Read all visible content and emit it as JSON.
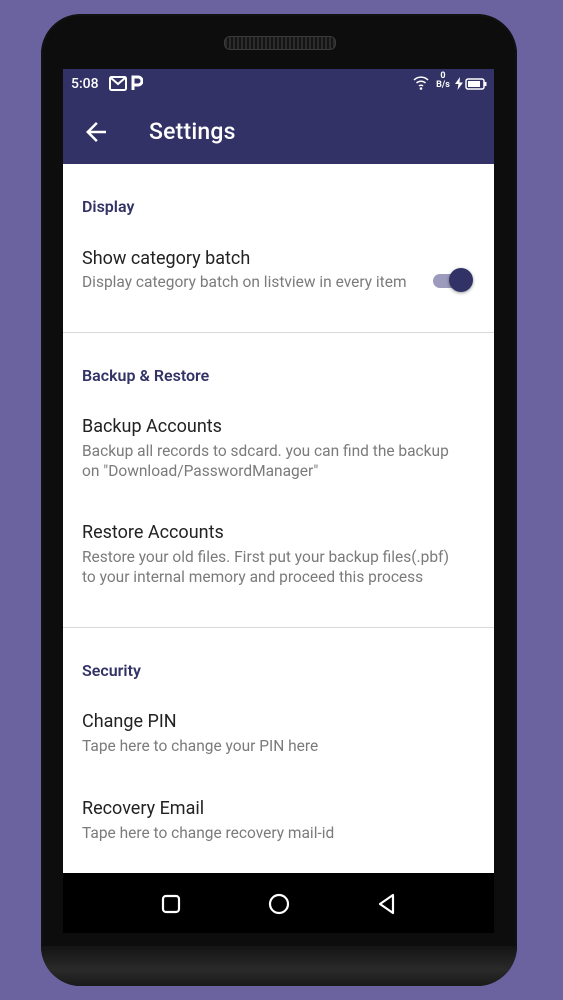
{
  "status_bar": {
    "time": "5:08",
    "icons": [
      "gmail-icon",
      "p-app-icon",
      "wifi-icon",
      "network-speed-icon",
      "charging-icon",
      "battery-icon"
    ],
    "net_speed_value": "0",
    "net_speed_unit": "B/s"
  },
  "app_bar": {
    "title": "Settings",
    "back_icon": "back-arrow-icon",
    "color": "#323266"
  },
  "sections": [
    {
      "header": "Display",
      "items": [
        {
          "title": "Show category batch",
          "subtitle": "Display category batch on listview in every item",
          "toggle_on": true
        }
      ]
    },
    {
      "header": "Backup & Restore",
      "items": [
        {
          "title": "Backup Accounts",
          "subtitle": "Backup all records to sdcard. you can find the backup on \"Download/PasswordManager\""
        },
        {
          "title": "Restore Accounts",
          "subtitle": "Restore your old files. First put your backup files(.pbf) to your internal memory and proceed this process"
        }
      ]
    },
    {
      "header": "Security",
      "items": [
        {
          "title": "Change PIN",
          "subtitle": "Tape here to change your PIN here"
        },
        {
          "title": "Recovery Email",
          "subtitle": "Tape here to change recovery mail-id"
        }
      ]
    }
  ],
  "nav_bar": {
    "buttons": [
      "recents-square-icon",
      "home-circle-icon",
      "back-triangle-icon"
    ]
  },
  "colors": {
    "background": "#6a639f",
    "primary": "#323266",
    "toggle_track": "#9d9bbd",
    "subtitle_text": "#7b7b7b"
  }
}
